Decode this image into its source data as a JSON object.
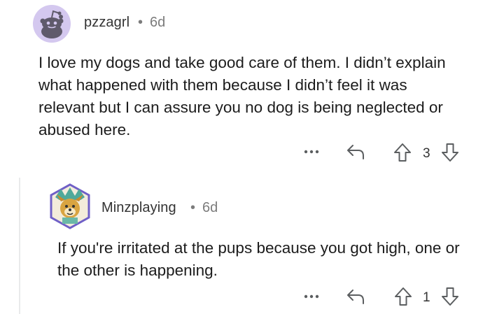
{
  "comments": [
    {
      "author": "pzzagrl",
      "separator": "•",
      "age": "6d",
      "body": "I love my dogs and take good care of them. I didn’t explain what happened with them because I didn’t feel it was relevant but I can assure you no dog is being neglected or abused here.",
      "score": "3",
      "avatar_icon": "snoo-avatar-icon"
    },
    {
      "author": "Minzplaying",
      "separator": "•",
      "age": "6d",
      "body": "If you're irritated at the pups because you got high, one or the other is happening.",
      "score": "1",
      "avatar_icon": "dog-avatar-icon"
    }
  ],
  "icons": {
    "more": "more-options-icon",
    "reply": "reply-icon",
    "upvote": "upvote-icon",
    "downvote": "downvote-icon"
  },
  "colors": {
    "avatar_bg": "#d4c8ef",
    "snoo_body": "#5f5a6b",
    "thread_line": "#e9eaeb",
    "meta_text": "#7c7c7c",
    "icon_stroke": "#5b5e60"
  }
}
